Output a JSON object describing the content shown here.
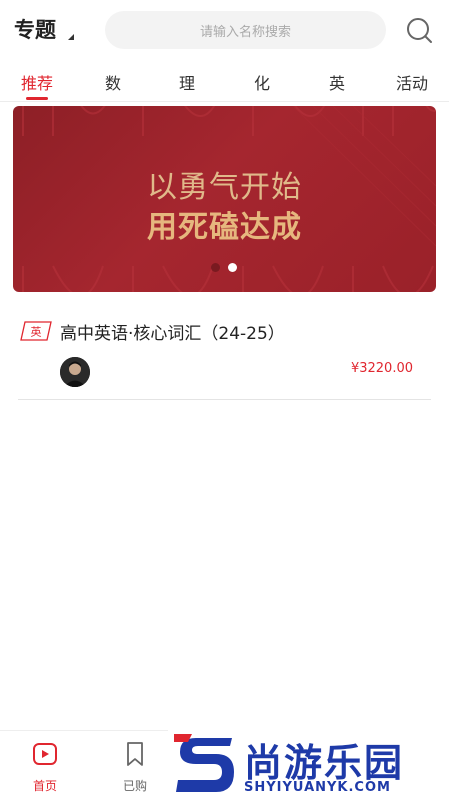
{
  "header": {
    "title": "专题",
    "search_placeholder": "请输入名称搜索"
  },
  "tabs": [
    {
      "label": "推荐",
      "active": true
    },
    {
      "label": "数"
    },
    {
      "label": "理"
    },
    {
      "label": "化"
    },
    {
      "label": "英"
    },
    {
      "label": "活动"
    }
  ],
  "banner": {
    "line1": "以勇气开始",
    "line2": "用死磕达成",
    "slide_count": 2,
    "active_slide": 2
  },
  "course": {
    "subject_badge": "英",
    "title": "高中英语·核心词汇（24-25）",
    "price": "¥3220.00"
  },
  "bottom_nav": [
    {
      "label": "首页",
      "icon": "home-play-icon",
      "active": true
    },
    {
      "label": "已购",
      "icon": "bookmark-icon"
    }
  ],
  "watermark": {
    "title": "尚游乐园",
    "subtitle": "SHYIYUANYK.COM"
  },
  "colors": {
    "accent": "#e0262f",
    "banner_bg": "#9a2129",
    "banner_text": "#e0b98a",
    "watermark": "#1e3aa8"
  }
}
